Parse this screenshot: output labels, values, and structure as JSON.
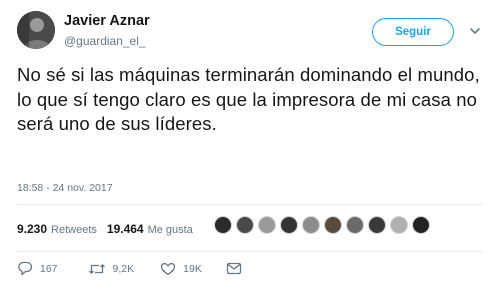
{
  "author": {
    "name": "Javier Aznar",
    "handle": "@guardian_el_",
    "avatar_icon": "user-avatar"
  },
  "follow": {
    "label": "Seguir"
  },
  "tweet": {
    "text": "No sé si las máquinas terminarán dominando el mundo, lo que sí tengo claro es que la impresora de mi casa no será uno de sus líderes.",
    "timestamp": "18:58 - 24 nov. 2017"
  },
  "stats": {
    "retweets_count": "9.230",
    "retweets_label": "Retweets",
    "likes_count": "19.464",
    "likes_label": "Me gusta"
  },
  "likers": {
    "count": 10,
    "colors": [
      "#2b2b2b",
      "#4a4a4a",
      "#9a9a9a",
      "#333333",
      "#8c8c8c",
      "#5a4a3a",
      "#6a6a6a",
      "#3a3a3a",
      "#b0b0b0",
      "#222222"
    ]
  },
  "actions": {
    "reply_count": "167",
    "retweet_count": "9,2K",
    "like_count": "19K"
  },
  "colors": {
    "accent": "#1da1f2",
    "secondary_text": "#657786",
    "primary_text": "#14171a"
  }
}
